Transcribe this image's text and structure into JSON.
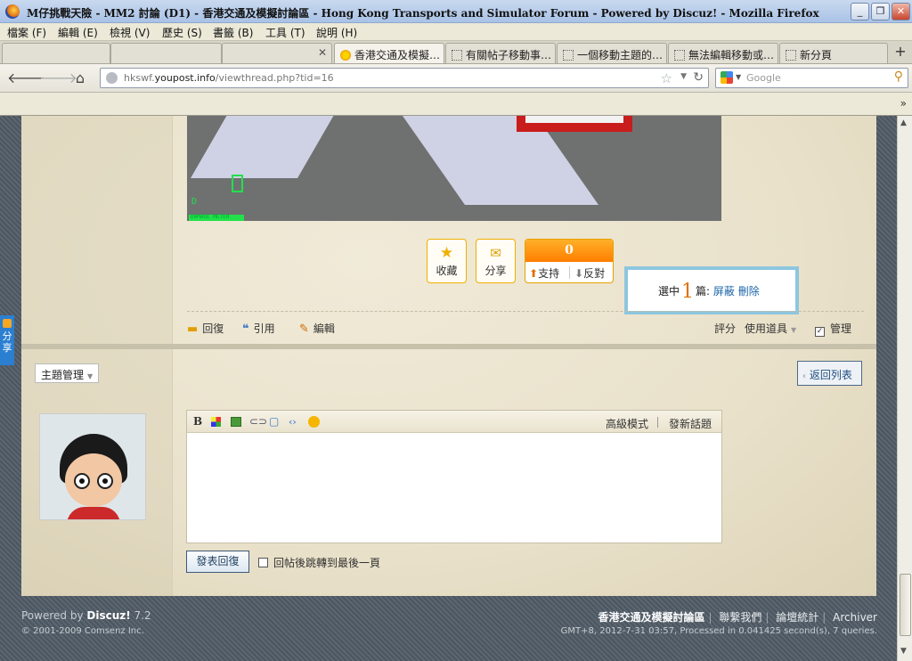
{
  "window": {
    "title": "M仔挑戰天險 - MM2 討論 (D1) - 香港交通及模擬討論區 - Hong Kong Transports and Simulator Forum - Powered by Discuz! - Mozilla Firefox"
  },
  "menu": [
    "檔案 (F)",
    "編輯 (E)",
    "檢視 (V)",
    "歷史 (S)",
    "書籤 (B)",
    "工具 (T)",
    "說明 (H)"
  ],
  "tabs": [
    {
      "label": "香港交通及模擬…",
      "active": true
    },
    {
      "label": "有關帖子移動事…",
      "active": false
    },
    {
      "label": "一個移動主題的…",
      "active": false
    },
    {
      "label": "無法編輯移動或…",
      "active": false
    },
    {
      "label": "新分頁",
      "active": false
    }
  ],
  "nav": {
    "url_prefix": "hkswf.",
    "url_domain": "youpost.info",
    "url_path": "/viewthread.php?tid=16",
    "search_placeholder": "Google"
  },
  "post": {
    "hud_small": "DAMAGE METER",
    "hud_gear": "D",
    "favorite_label": "收藏",
    "share_label": "分享",
    "vote_count": "0",
    "support_label": "支持",
    "oppose_label": "反對",
    "select_prefix": "選中",
    "select_count": "1",
    "select_suffix": "篇:",
    "select_shield": "屏蔽",
    "select_delete": "刪除",
    "reply_label": "回復",
    "quote_label": "引用",
    "edit_label": "編輯",
    "rate_label": "評分",
    "tools_label": "使用道具",
    "manage_label": "管理"
  },
  "thread": {
    "topic_manage": "主題管理",
    "back_to_list": "返回列表"
  },
  "editor": {
    "advanced_mode": "高級模式",
    "new_topic": "發新話題",
    "submit_label": "發表回復",
    "jump_last_label": "回帖後跳轉到最後一頁"
  },
  "sidebar": {
    "share_label": "分享"
  },
  "footer": {
    "powered_prefix": "Powered by ",
    "powered_brand": "Discuz!",
    "powered_version": " 7.2",
    "copyright": "© 2001-2009 Comsenz Inc.",
    "site_name": "香港交通及模擬討論區",
    "contact": "聯繫我們",
    "stats": "論壇統計",
    "archiver": "Archiver",
    "server_info": "GMT+8, 2012-7-31 03:57, Processed in 0.041425 second(s), 7 queries."
  }
}
